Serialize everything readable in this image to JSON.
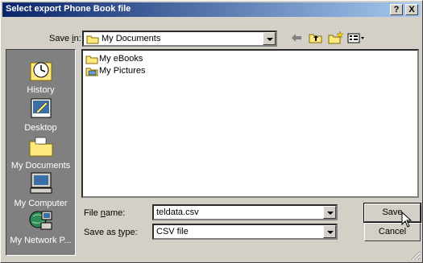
{
  "window": {
    "title": "Select export Phone Book file",
    "help_label": "?",
    "close_label": "X"
  },
  "save_in": {
    "label_before": "Save ",
    "label_key": "i",
    "label_after": "n:",
    "value": "My Documents"
  },
  "places": [
    {
      "label": "History",
      "icon": "history-icon"
    },
    {
      "label": "Desktop",
      "icon": "desktop-icon"
    },
    {
      "label": "My Documents",
      "icon": "folder-icon"
    },
    {
      "label": "My Computer",
      "icon": "computer-icon"
    },
    {
      "label": "My Network P...",
      "icon": "network-icon"
    }
  ],
  "files": [
    {
      "label": "My eBooks",
      "icon": "folder-icon"
    },
    {
      "label": "My Pictures",
      "icon": "pictures-folder-icon"
    }
  ],
  "file_name": {
    "label_before": "File ",
    "label_key": "n",
    "label_after": "ame:",
    "value": "teldata.csv"
  },
  "save_as_type": {
    "label_before": "Save as ",
    "label_key": "t",
    "label_after": "ype:",
    "value": "CSV file"
  },
  "buttons": {
    "save": "Save",
    "cancel": "Cancel"
  },
  "colors": {
    "title_start": "#0a246a",
    "title_end": "#a6caf0",
    "face": "#d4d0c8",
    "places_bg": "#808080"
  }
}
